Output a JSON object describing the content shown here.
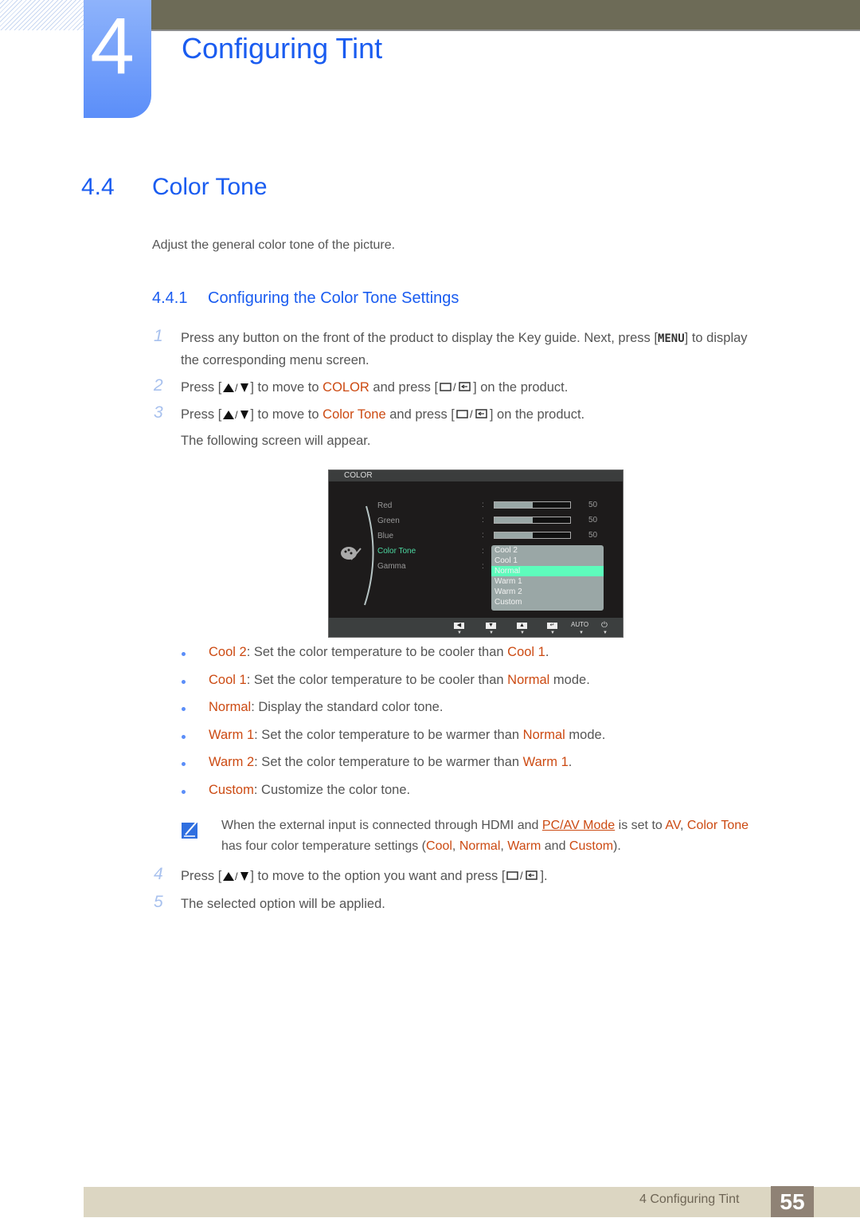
{
  "chapter": {
    "number": "4",
    "title": "Configuring Tint"
  },
  "section": {
    "number": "4.4",
    "title": "Color Tone",
    "intro": "Adjust the general color tone of the picture."
  },
  "subsection": {
    "number": "4.4.1",
    "title": "Configuring the Color Tone Settings"
  },
  "steps": [
    {
      "num": "1",
      "line1_a": "Press any button on the front of the product to display the Key guide. Next, press [",
      "key": "MENU",
      "line1_b": "] to display",
      "line2": "the corresponding menu screen."
    },
    {
      "num": "2",
      "a": "Press [",
      "b": "] to move to ",
      "hl": "COLOR",
      "c": " and press [",
      "d": "] on the product."
    },
    {
      "num": "3",
      "a": "Press [",
      "b": "] to move to ",
      "hl": "Color Tone",
      "c": " and press [",
      "d": "] on the product.",
      "follow": "The following screen will appear."
    },
    {
      "num": "4",
      "a": "Press [",
      "b": "] to move to the option you want and press [",
      "c": "]."
    },
    {
      "num": "5",
      "text": "The selected option will be applied."
    }
  ],
  "osd": {
    "title": "COLOR",
    "items": [
      {
        "label": "Red",
        "value": "50",
        "level_percent": 50
      },
      {
        "label": "Green",
        "value": "50",
        "level_percent": 50
      },
      {
        "label": "Blue",
        "value": "50",
        "level_percent": 50
      },
      {
        "label": "Color Tone"
      },
      {
        "label": "Gamma"
      }
    ],
    "colon": ":",
    "dropdown_options": [
      "Cool 2",
      "Cool 1",
      "Normal",
      "Warm 1",
      "Warm 2",
      "Custom"
    ],
    "selected_option": "Normal",
    "footer_keys": [
      "◀",
      "▼",
      "▲",
      "↵",
      "AUTO",
      "⏻"
    ],
    "colors": {
      "active_item": "#4dd9a2",
      "selected_option": "#5efcbc"
    }
  },
  "options": [
    {
      "name": "Cool 2",
      "desc": ": Set the color temperature to be cooler than ",
      "ref": "Cool 1",
      "tail": "."
    },
    {
      "name": "Cool 1",
      "desc": ": Set the color temperature to be cooler than ",
      "ref": "Normal",
      "tail": " mode."
    },
    {
      "name": "Normal",
      "desc": ": Display the standard color tone.",
      "ref": "",
      "tail": ""
    },
    {
      "name": "Warm 1",
      "desc": ": Set the color temperature to be warmer than ",
      "ref": "Normal",
      "tail": " mode."
    },
    {
      "name": "Warm 2",
      "desc": ": Set the color temperature to be warmer than ",
      "ref": "Warm 1",
      "tail": "."
    },
    {
      "name": "Custom",
      "desc": ": Customize the color tone.",
      "ref": "",
      "tail": ""
    }
  ],
  "note": {
    "a": "When the external input is connected through HDMI and ",
    "link": "PC/AV Mode",
    "b": " is set to ",
    "av": "AV",
    "c": ", ",
    "ct": "Color Tone",
    "d": "has four color temperature settings (",
    "cool": "Cool",
    "sep1": ", ",
    "normal": "Normal",
    "sep2": ", ",
    "warm": "Warm",
    "and": " and ",
    "custom": "Custom",
    "end": ")."
  },
  "footer": {
    "chapter_label": "4 Configuring Tint",
    "page": "55"
  },
  "colors": {
    "heading_blue": "#1a5cf0",
    "highlight_orange": "#cc4a12",
    "topbar": "#6d6b57",
    "footer_bar": "#dcd6c2",
    "page_box": "#8f8275"
  }
}
